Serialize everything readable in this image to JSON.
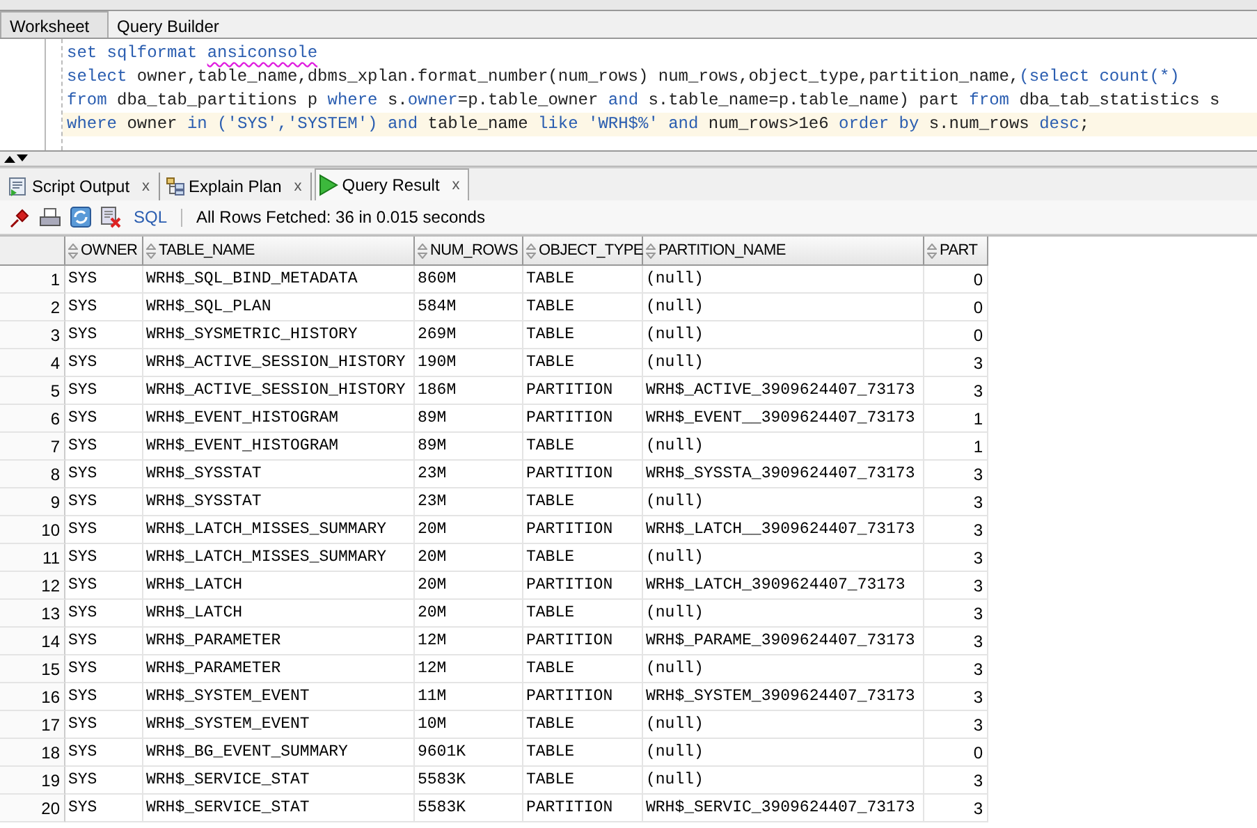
{
  "editor_tabs": [
    {
      "label": "Worksheet",
      "selected": true
    },
    {
      "label": "Query Builder",
      "selected": false
    }
  ],
  "editor": {
    "lines": [
      {
        "current": false,
        "tokens": [
          {
            "kind": "kw",
            "text": "set sqlformat "
          },
          {
            "kind": "err",
            "text": "ansiconsole"
          }
        ]
      },
      {
        "current": false,
        "tokens": [
          {
            "kind": "kw",
            "text": "select "
          },
          {
            "kind": "id",
            "text": "owner,table_name,dbms_xplan.format_number(num_rows) num_rows,object_type,partition_name,"
          },
          {
            "kind": "kw",
            "text": "(select count(*)"
          }
        ]
      },
      {
        "current": false,
        "tokens": [
          {
            "kind": "kw",
            "text": "from "
          },
          {
            "kind": "id",
            "text": "dba_tab_partitions p "
          },
          {
            "kind": "kw",
            "text": "where "
          },
          {
            "kind": "id",
            "text": "s."
          },
          {
            "kind": "kw",
            "text": "owner"
          },
          {
            "kind": "id",
            "text": "=p.table_owner "
          },
          {
            "kind": "kw",
            "text": "and "
          },
          {
            "kind": "id",
            "text": "s.table_name=p.table_name) part "
          },
          {
            "kind": "kw",
            "text": "from "
          },
          {
            "kind": "id",
            "text": "dba_tab_statistics s"
          }
        ]
      },
      {
        "current": true,
        "tokens": [
          {
            "kind": "kw",
            "text": "where "
          },
          {
            "kind": "id",
            "text": "owner "
          },
          {
            "kind": "kw",
            "text": "in ('SYS','SYSTEM') and "
          },
          {
            "kind": "id",
            "text": "table_name "
          },
          {
            "kind": "kw",
            "text": "like 'WRH$%' and "
          },
          {
            "kind": "id",
            "text": "num_rows>1e6 "
          },
          {
            "kind": "kw",
            "text": "order by "
          },
          {
            "kind": "id",
            "text": "s.num_rows "
          },
          {
            "kind": "kw",
            "text": "desc"
          },
          {
            "kind": "id",
            "text": ";"
          }
        ]
      }
    ]
  },
  "result_tabs": [
    {
      "label": "Script Output",
      "selected": false,
      "close": "x"
    },
    {
      "label": "Explain Plan",
      "selected": false,
      "close": "x"
    },
    {
      "label": "Query Result",
      "selected": true,
      "close": "x"
    }
  ],
  "toolbar": {
    "sql_link": "SQL",
    "status": "All Rows Fetched: 36 in 0.015 seconds"
  },
  "table": {
    "columns": [
      "OWNER",
      "TABLE_NAME",
      "NUM_ROWS",
      "OBJECT_TYPE",
      "PARTITION_NAME",
      "PART"
    ],
    "rows": [
      {
        "number": "1",
        "cells": [
          "SYS",
          "WRH$_SQL_BIND_METADATA",
          "860M",
          "TABLE",
          "(null)",
          "0"
        ]
      },
      {
        "number": "2",
        "cells": [
          "SYS",
          "WRH$_SQL_PLAN",
          "584M",
          "TABLE",
          "(null)",
          "0"
        ]
      },
      {
        "number": "3",
        "cells": [
          "SYS",
          "WRH$_SYSMETRIC_HISTORY",
          "269M",
          "TABLE",
          "(null)",
          "0"
        ]
      },
      {
        "number": "4",
        "cells": [
          "SYS",
          "WRH$_ACTIVE_SESSION_HISTORY",
          "190M",
          "TABLE",
          "(null)",
          "3"
        ]
      },
      {
        "number": "5",
        "cells": [
          "SYS",
          "WRH$_ACTIVE_SESSION_HISTORY",
          "186M",
          "PARTITION",
          "WRH$_ACTIVE_3909624407_73173",
          "3"
        ]
      },
      {
        "number": "6",
        "cells": [
          "SYS",
          "WRH$_EVENT_HISTOGRAM",
          "89M",
          "PARTITION",
          "WRH$_EVENT__3909624407_73173",
          "1"
        ]
      },
      {
        "number": "7",
        "cells": [
          "SYS",
          "WRH$_EVENT_HISTOGRAM",
          "89M",
          "TABLE",
          "(null)",
          "1"
        ]
      },
      {
        "number": "8",
        "cells": [
          "SYS",
          "WRH$_SYSSTAT",
          "23M",
          "PARTITION",
          "WRH$_SYSSTA_3909624407_73173",
          "3"
        ]
      },
      {
        "number": "9",
        "cells": [
          "SYS",
          "WRH$_SYSSTAT",
          "23M",
          "TABLE",
          "(null)",
          "3"
        ]
      },
      {
        "number": "10",
        "cells": [
          "SYS",
          "WRH$_LATCH_MISSES_SUMMARY",
          "20M",
          "PARTITION",
          "WRH$_LATCH__3909624407_73173",
          "3"
        ]
      },
      {
        "number": "11",
        "cells": [
          "SYS",
          "WRH$_LATCH_MISSES_SUMMARY",
          "20M",
          "TABLE",
          "(null)",
          "3"
        ]
      },
      {
        "number": "12",
        "cells": [
          "SYS",
          "WRH$_LATCH",
          "20M",
          "PARTITION",
          "WRH$_LATCH_3909624407_73173",
          "3"
        ]
      },
      {
        "number": "13",
        "cells": [
          "SYS",
          "WRH$_LATCH",
          "20M",
          "TABLE",
          "(null)",
          "3"
        ]
      },
      {
        "number": "14",
        "cells": [
          "SYS",
          "WRH$_PARAMETER",
          "12M",
          "PARTITION",
          "WRH$_PARAME_3909624407_73173",
          "3"
        ]
      },
      {
        "number": "15",
        "cells": [
          "SYS",
          "WRH$_PARAMETER",
          "12M",
          "TABLE",
          "(null)",
          "3"
        ]
      },
      {
        "number": "16",
        "cells": [
          "SYS",
          "WRH$_SYSTEM_EVENT",
          "11M",
          "PARTITION",
          "WRH$_SYSTEM_3909624407_73173",
          "3"
        ]
      },
      {
        "number": "17",
        "cells": [
          "SYS",
          "WRH$_SYSTEM_EVENT",
          "10M",
          "TABLE",
          "(null)",
          "3"
        ]
      },
      {
        "number": "18",
        "cells": [
          "SYS",
          "WRH$_BG_EVENT_SUMMARY",
          "9601K",
          "TABLE",
          "(null)",
          "0"
        ]
      },
      {
        "number": "19",
        "cells": [
          "SYS",
          "WRH$_SERVICE_STAT",
          "5583K",
          "TABLE",
          "(null)",
          "3"
        ]
      },
      {
        "number": "20",
        "cells": [
          "SYS",
          "WRH$_SERVICE_STAT",
          "5583K",
          "PARTITION",
          "WRH$_SERVIC_3909624407_73173",
          "3"
        ]
      }
    ]
  }
}
